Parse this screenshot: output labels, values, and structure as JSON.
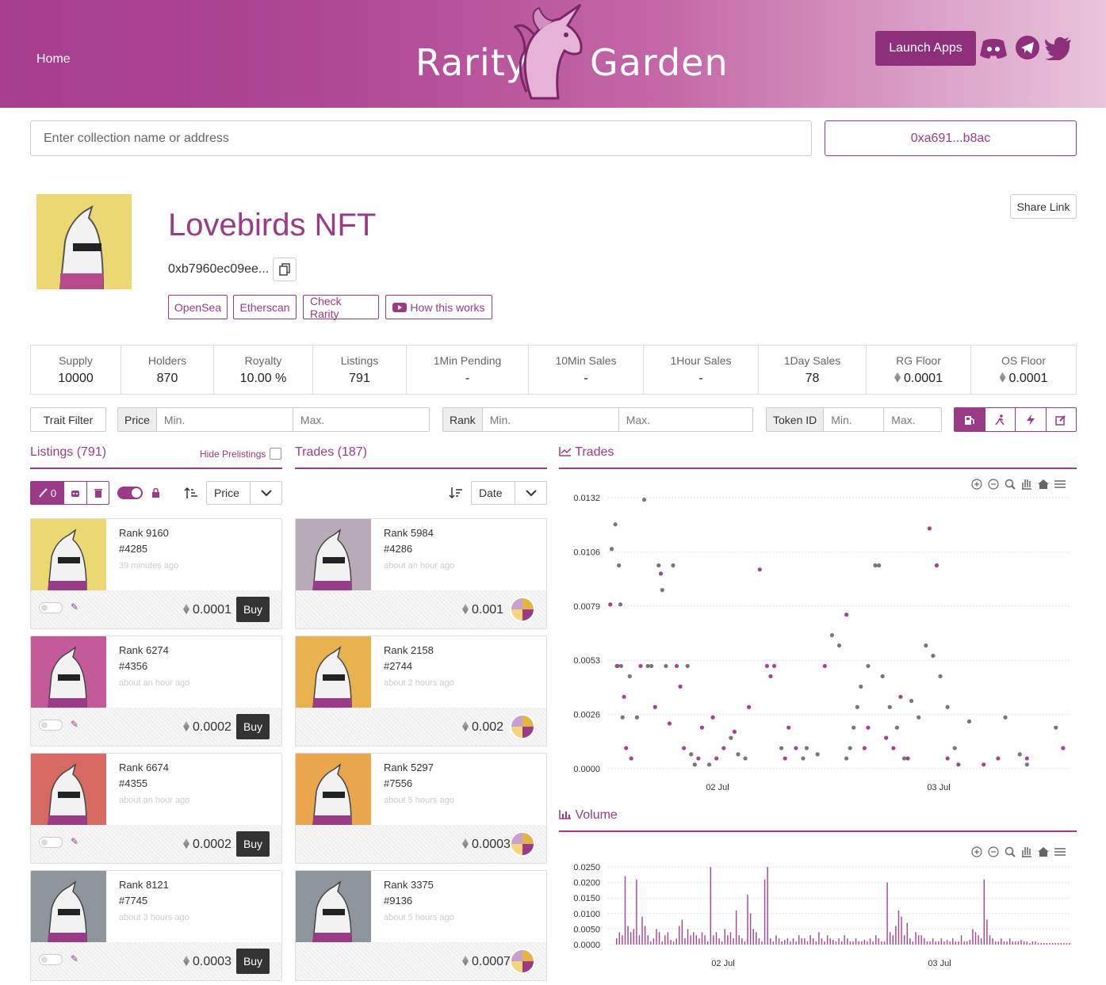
{
  "header": {
    "home": "Home",
    "logo_left": "Rarity",
    "logo_right": "Garden",
    "launch": "Launch Apps",
    "social": [
      "discord-icon",
      "telegram-icon",
      "twitter-icon"
    ]
  },
  "search": {
    "placeholder": "Enter collection name or address",
    "wallet": "0xa691...b8ac"
  },
  "collection": {
    "title": "Lovebirds NFT",
    "address": "0xb7960ec09ee...",
    "links": [
      "OpenSea",
      "Etherscan",
      "Check Rarity",
      "How this works"
    ],
    "share": "Share Link"
  },
  "stats": [
    {
      "k": "Supply",
      "v": "10000"
    },
    {
      "k": "Holders",
      "v": "870"
    },
    {
      "k": "Royalty",
      "v": "10.00 %"
    },
    {
      "k": "Listings",
      "v": "791"
    },
    {
      "k": "1Min Pending",
      "v": "-"
    },
    {
      "k": "10Min Sales",
      "v": "-"
    },
    {
      "k": "1Hour Sales",
      "v": "-"
    },
    {
      "k": "1Day Sales",
      "v": "78"
    },
    {
      "k": "RG Floor",
      "v": "0.0001"
    },
    {
      "k": "OS Floor",
      "v": "0.0001"
    }
  ],
  "filters": {
    "trait": "Trait Filter",
    "price": {
      "label": "Price",
      "min": "Min.",
      "max": "Max."
    },
    "rank": {
      "label": "Rank",
      "min": "Min.",
      "max": "Max."
    },
    "token": {
      "label": "Token ID",
      "min": "Min.",
      "max": "Max."
    }
  },
  "listings": {
    "title": "Listings (791)",
    "hide": "Hide Prelistings",
    "sweep_count": "0",
    "sort": "Price",
    "items": [
      {
        "rank": "Rank 9160",
        "id": "#4285",
        "ago": "39 minutes ago",
        "price": "0.0001",
        "buy": "Buy",
        "bg": "#ecd872"
      },
      {
        "rank": "Rank 6274",
        "id": "#4356",
        "ago": "about an hour ago",
        "price": "0.0002",
        "buy": "Buy",
        "bg": "#c45a9a"
      },
      {
        "rank": "Rank 6674",
        "id": "#4355",
        "ago": "about an hour ago",
        "price": "0.0002",
        "buy": "Buy",
        "bg": "#d66a62"
      },
      {
        "rank": "Rank 8121",
        "id": "#7745",
        "ago": "about 3 hours ago",
        "price": "0.0003",
        "buy": "Buy",
        "bg": "#8f959c"
      }
    ]
  },
  "trades": {
    "title": "Trades (187)",
    "sort": "Date",
    "items": [
      {
        "rank": "Rank 5984",
        "id": "#4286",
        "ago": "about an hour ago",
        "price": "0.001",
        "bg": "#b9aab8"
      },
      {
        "rank": "Rank 2158",
        "id": "#2744",
        "ago": "about 2 hours ago",
        "price": "0.002",
        "bg": "#e9b24e"
      },
      {
        "rank": "Rank 5297",
        "id": "#7556",
        "ago": "about 5 hours ago",
        "price": "0.0003",
        "bg": "#e9a64c"
      },
      {
        "rank": "Rank 3375",
        "id": "#9136",
        "ago": "about 5 hours ago",
        "price": "0.0007",
        "bg": "#8f959c"
      }
    ]
  },
  "chart_data": [
    {
      "type": "scatter",
      "title": "Trades",
      "yticks": [
        "0.0132",
        "0.0106",
        "0.0079",
        "0.0053",
        "0.0026",
        "0.0000"
      ],
      "ylim": [
        0,
        0.0132
      ],
      "xticks": [
        "02 Jul",
        "03 Jul"
      ],
      "series": [
        {
          "color": "#777777",
          "points": [
            [
              0.5,
              0.0107
            ],
            [
              1,
              0.0119
            ],
            [
              1.5,
              0.0099
            ],
            [
              1.7,
              0.008
            ],
            [
              5,
              0.0131
            ],
            [
              7,
              0.0099
            ],
            [
              7.5,
              0.0087
            ],
            [
              9,
              0.0099
            ],
            [
              1.2,
              0.005
            ],
            [
              1.8,
              0.005
            ],
            [
              4,
              0.0025
            ],
            [
              5.5,
              0.005
            ],
            [
              6,
              0.005
            ],
            [
              8,
              0.005
            ],
            [
              3,
              0.0045
            ],
            [
              2,
              0.0025
            ],
            [
              11,
              0.005
            ],
            [
              11.5,
              0.0007
            ],
            [
              12,
              0.0002
            ],
            [
              14,
              0.0002
            ],
            [
              17,
              0.0015
            ],
            [
              18,
              0.0007
            ],
            [
              19,
              0.0005
            ],
            [
              24,
              0.001
            ],
            [
              27,
              0.0005
            ],
            [
              27.5,
              0.001
            ],
            [
              29,
              0.0007
            ],
            [
              31,
              0.0065
            ],
            [
              32,
              0.006
            ],
            [
              33,
              0.0005
            ],
            [
              33.5,
              0.001
            ],
            [
              34,
              0.002
            ],
            [
              34.5,
              0.003
            ],
            [
              35,
              0.004
            ],
            [
              36,
              0.005
            ],
            [
              37,
              0.0099
            ],
            [
              37.5,
              0.0099
            ],
            [
              38,
              0.0045
            ],
            [
              39,
              0.003
            ],
            [
              40,
              0.002
            ],
            [
              41,
              0.0005
            ],
            [
              42,
              0.0033
            ],
            [
              43,
              0.0025
            ],
            [
              44,
              0.006
            ],
            [
              45,
              0.0055
            ],
            [
              46,
              0.0045
            ],
            [
              47,
              0.003
            ],
            [
              48,
              0.001
            ],
            [
              50,
              0.0023
            ],
            [
              55,
              0.0025
            ],
            [
              57,
              0.0007
            ],
            [
              58,
              0.0002
            ],
            [
              62,
              0.002
            ]
          ]
        },
        {
          "color": "#a8418f",
          "points": [
            [
              0.3,
              0.008
            ],
            [
              1.3,
              0.005
            ],
            [
              2.2,
              0.0035
            ],
            [
              2.5,
              0.001
            ],
            [
              3.2,
              0.0005
            ],
            [
              4.5,
              0.005
            ],
            [
              6.5,
              0.003
            ],
            [
              7.3,
              0.0095
            ],
            [
              8.5,
              0.0022
            ],
            [
              9.5,
              0.005
            ],
            [
              10,
              0.004
            ],
            [
              10.5,
              0.001
            ],
            [
              12.5,
              0.0005
            ],
            [
              13,
              0.002
            ],
            [
              14.5,
              0.0025
            ],
            [
              15,
              0.0005
            ],
            [
              16,
              0.001
            ],
            [
              17.5,
              0.0018
            ],
            [
              19.5,
              0.003
            ],
            [
              21,
              0.0097
            ],
            [
              22,
              0.005
            ],
            [
              22.5,
              0.0045
            ],
            [
              23,
              0.005
            ],
            [
              24.5,
              0.0005
            ],
            [
              25,
              0.002
            ],
            [
              26,
              0.001
            ],
            [
              30,
              0.005
            ],
            [
              33,
              0.0075
            ],
            [
              35.5,
              0.001
            ],
            [
              36,
              0.002
            ],
            [
              38.5,
              0.0015
            ],
            [
              39.5,
              0.001
            ],
            [
              40.5,
              0.0035
            ],
            [
              41.5,
              0.0005
            ],
            [
              44.5,
              0.0117
            ],
            [
              45.5,
              0.0099
            ],
            [
              47,
              0.0005
            ],
            [
              48.5,
              0.0002
            ],
            [
              52,
              0.0002
            ],
            [
              54,
              0.0005
            ],
            [
              58,
              0.0005
            ],
            [
              63,
              0.001
            ]
          ]
        }
      ]
    },
    {
      "type": "bar",
      "title": "Volume",
      "yticks": [
        "0.0250",
        "0.0200",
        "0.0150",
        "0.0100",
        "0.0050",
        "0.0000"
      ],
      "ylim": [
        0,
        0.025
      ],
      "xticks": [
        "02 Jul",
        "03 Jul"
      ],
      "values": [
        0.002,
        0.004,
        0.003,
        0.022,
        0.006,
        0.004,
        0.005,
        0.021,
        0.003,
        0.009,
        0.006,
        0.003,
        0.001,
        0.002,
        0.005,
        0.004,
        0.001,
        0.003,
        0.004,
        0.0015,
        0.001,
        0.002,
        0.006,
        0.008,
        0.002,
        0.005,
        0.003,
        0.004,
        0.003,
        0.002,
        0.004,
        0.003,
        0.001,
        0.025,
        0.003,
        0.004,
        0.002,
        0.001,
        0.005,
        0.003,
        0.004,
        0.002,
        0.011,
        0.003,
        0.002,
        0.001,
        0.016,
        0.01,
        0.005,
        0.004,
        0.002,
        0.001,
        0.021,
        0.025,
        0.002,
        0.001,
        0.003,
        0.002,
        0.001,
        0.0015,
        0.002,
        0.001,
        0.002,
        0.001,
        0.003,
        0.002,
        0.002,
        0.001,
        0.003,
        0.002,
        0.001,
        0.004,
        0.002,
        0.001,
        0.003,
        0.002,
        0.0015,
        0.001,
        0.002,
        0.001,
        0.003,
        0.002,
        0.001,
        0.001,
        0.002,
        0.001,
        0.001,
        0.0015,
        0.001,
        0.002,
        0.001,
        0.003,
        0.002,
        0.001,
        0.001,
        0.02,
        0.004,
        0.003,
        0.006,
        0.011,
        0.009,
        0.003,
        0.007,
        0.002,
        0.001,
        0.004,
        0.003,
        0.003,
        0.002,
        0.001,
        0.001,
        0.002,
        0.001,
        0.001,
        0.002,
        0.001,
        0.0015,
        0.001,
        0.002,
        0.001,
        0.001,
        0.003,
        0.001,
        0.001,
        0.0015,
        0.005,
        0.004,
        0.003,
        0.002,
        0.021,
        0.008,
        0.003,
        0.002,
        0.001,
        0.001,
        0.002,
        0.001,
        0.001,
        0.002,
        0.001,
        0.001,
        0.001,
        0.0015,
        0.001,
        0.001,
        0.0005,
        0.001,
        0.001,
        0.0005,
        0.0005,
        0.0005,
        0.0005,
        0.0005,
        0.0005,
        0.0005,
        0.0005,
        0.0005,
        0.0005,
        0.0005,
        0.0005
      ]
    }
  ]
}
